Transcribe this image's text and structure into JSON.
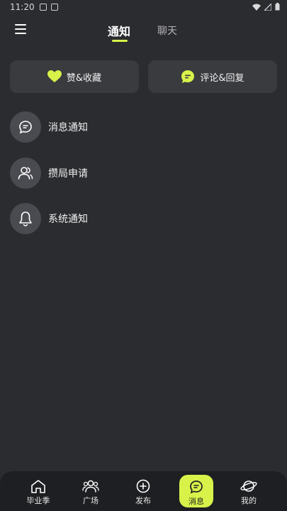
{
  "status_bar": {
    "time": "11:20"
  },
  "header": {
    "tabs": [
      {
        "label": "通知",
        "active": true
      },
      {
        "label": "聊天",
        "active": false
      }
    ]
  },
  "quick_cards": {
    "likes_label": "赞&收藏",
    "comments_label": "评论&回复"
  },
  "notification_list": [
    {
      "label": "消息通知",
      "icon": "message-icon"
    },
    {
      "label": "攒局申请",
      "icon": "users-icon"
    },
    {
      "label": "系统通知",
      "icon": "bell-icon"
    }
  ],
  "bottom_nav": [
    {
      "label": "毕业季",
      "icon": "home-icon"
    },
    {
      "label": "广场",
      "icon": "group-icon"
    },
    {
      "label": "发布",
      "icon": "plus-circle-icon"
    },
    {
      "label": "消息",
      "icon": "message-icon",
      "active": true
    },
    {
      "label": "我的",
      "icon": "planet-icon"
    }
  ],
  "colors": {
    "accent": "#d8f24a",
    "background": "#2b2c2f",
    "card": "#3a3b3f",
    "nav": "#1e1f22"
  }
}
